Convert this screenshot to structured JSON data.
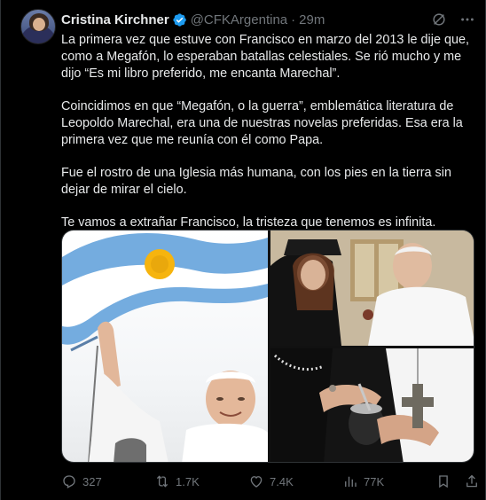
{
  "tweet": {
    "author_name": "Cristina Kirchner",
    "handle": "@CFKArgentina",
    "separator": "·",
    "time": "29m",
    "paragraphs": [
      "La primera vez que estuve con Francisco en marzo del 2013 le dije que, como a Megafón, lo esperaban batallas celestiales. Se rió mucho y me dijo “Es mi libro preferido, me encanta Marechal”.",
      "Coincidimos en que “Megafón, o la guerra”, emblemática literatura de Leopoldo Marechal, era una de nuestras novelas preferidas. Esa era la primera vez que me reunía con él como Papa.",
      "Fue el rostro de una Iglesia más humana, con los pies en la tierra sin dejar de mirar el cielo.",
      "Te vamos a extrañar Francisco, la tristeza que tenemos es infinita."
    ]
  },
  "actions": {
    "replies": "327",
    "reposts": "1.7K",
    "likes": "7.4K",
    "views": "77K"
  },
  "icons": {
    "verified": "verified-badge-icon",
    "grok": "grok-icon",
    "more": "more-icon",
    "reply": "reply-icon",
    "repost": "repost-icon",
    "like": "heart-icon",
    "views": "views-chart-icon",
    "bookmark": "bookmark-icon",
    "share": "share-icon"
  },
  "colors": {
    "background": "#000000",
    "text": "#e7e9ea",
    "muted": "#71767b",
    "verified": "#1d9bf0",
    "border": "#2f3336"
  }
}
